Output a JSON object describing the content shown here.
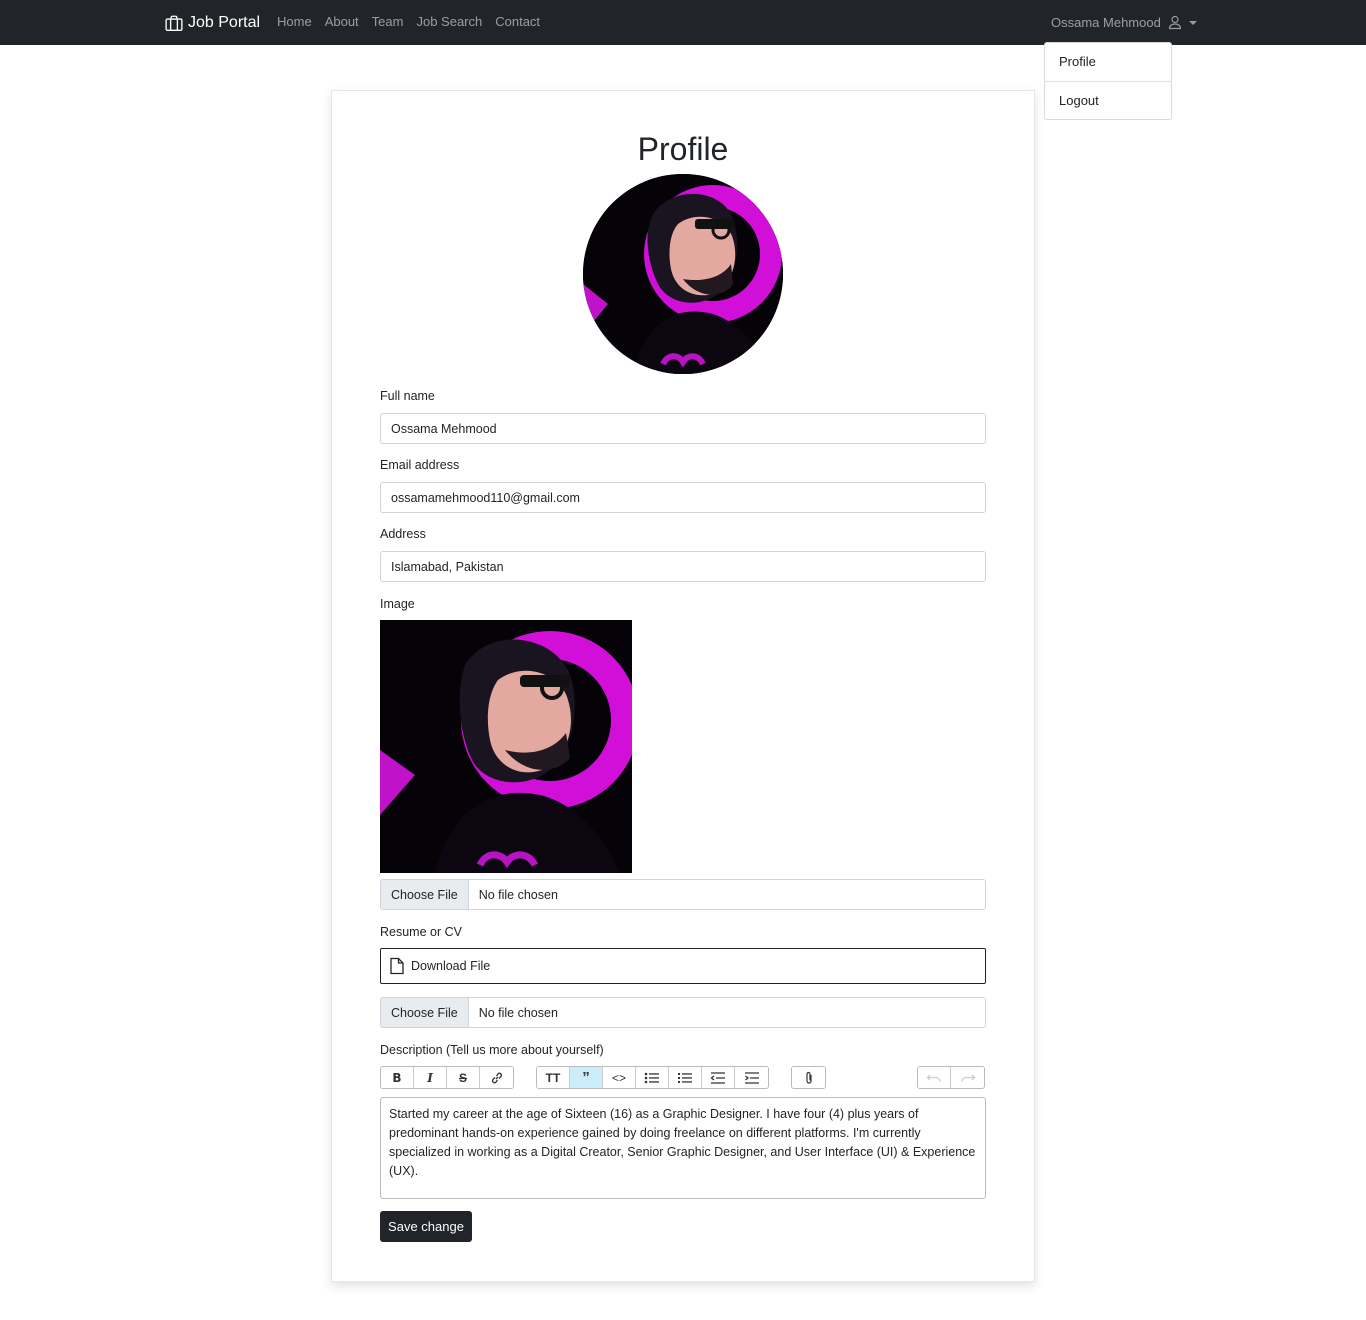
{
  "navbar": {
    "brand": "Job Portal",
    "brand_icon": "briefcase-icon",
    "links": [
      {
        "label": "Home"
      },
      {
        "label": "About"
      },
      {
        "label": "Team"
      },
      {
        "label": "Job Search"
      },
      {
        "label": "Contact"
      }
    ],
    "user_name": "Ossama Mehmood",
    "user_icon": "person-icon"
  },
  "dropdown": {
    "items": [
      {
        "label": "Profile"
      },
      {
        "label": "Logout"
      }
    ]
  },
  "profile": {
    "title": "Profile",
    "full_name_label": "Full name",
    "full_name": "Ossama Mehmood",
    "email_label": "Email address",
    "email": "ossamamehmood110@gmail.com",
    "address_label": "Address",
    "address": "Islamabad, Pakistan",
    "image_label": "Image",
    "image_file": {
      "button": "Choose File",
      "status": "No file chosen"
    },
    "resume_label": "Resume or CV",
    "download_label": "Download File",
    "resume_file": {
      "button": "Choose File",
      "status": "No file chosen"
    },
    "description_label": "Description (Tell us more about yourself)",
    "description": "Started my career at the age of Sixteen (16) as a Graphic Designer. I have four (4) plus years of predominant hands-on experience gained by doing freelance on different platforms. I'm currently specialized in working as a Digital Creator, Senior Graphic Designer, and User Interface (UI) & Experience (UX).",
    "save_label": "Save change"
  },
  "toolbar": {
    "groups": [
      [
        "bold-icon",
        "italic-icon",
        "strikethrough-icon",
        "link-icon"
      ],
      [
        "heading-icon",
        "quote-icon",
        "code-icon",
        "bullet-list-icon",
        "number-list-icon",
        "outdent-icon",
        "indent-icon"
      ],
      [
        "attach-icon"
      ],
      [
        "undo-icon",
        "redo-icon"
      ]
    ],
    "active": "quote-icon"
  },
  "colors": {
    "navbar_bg": "#212529",
    "accent_magenta": "#e010e0",
    "button_dark": "#212529",
    "toolbar_active": "#cbeefa"
  }
}
